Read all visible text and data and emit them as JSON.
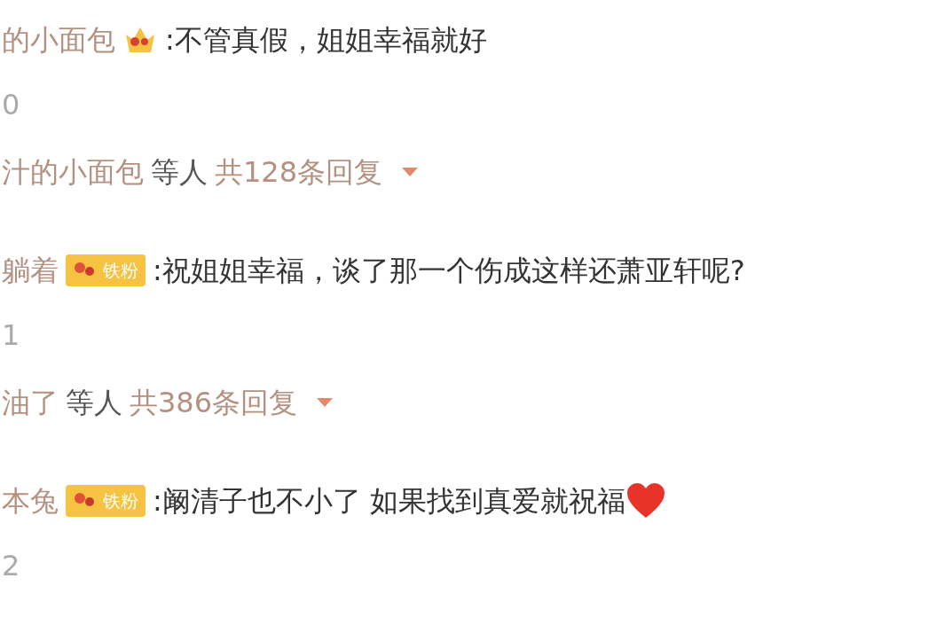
{
  "comments": [
    {
      "user": "的小面包",
      "badge": {
        "kind": "crown"
      },
      "text": ":不管真假，姐姐幸福就好",
      "heart": false,
      "likes": "0",
      "replies": {
        "users": "汁的小面包",
        "suffix": "等人",
        "count": "共128条回复"
      }
    },
    {
      "user": "躺着",
      "badge": {
        "kind": "fan",
        "label": "铁粉"
      },
      "text": ":祝姐姐幸福，谈了那一个伤成这样还萧亚轩呢?",
      "heart": false,
      "likes": "1",
      "replies": {
        "users": "油了",
        "suffix": "等人",
        "count": "共386条回复"
      }
    },
    {
      "user": "本兔",
      "badge": {
        "kind": "fan",
        "label": "铁粉"
      },
      "text": ":阚清子也不小了 如果找到真爱就祝福",
      "heart": true,
      "likes": "2"
    }
  ]
}
